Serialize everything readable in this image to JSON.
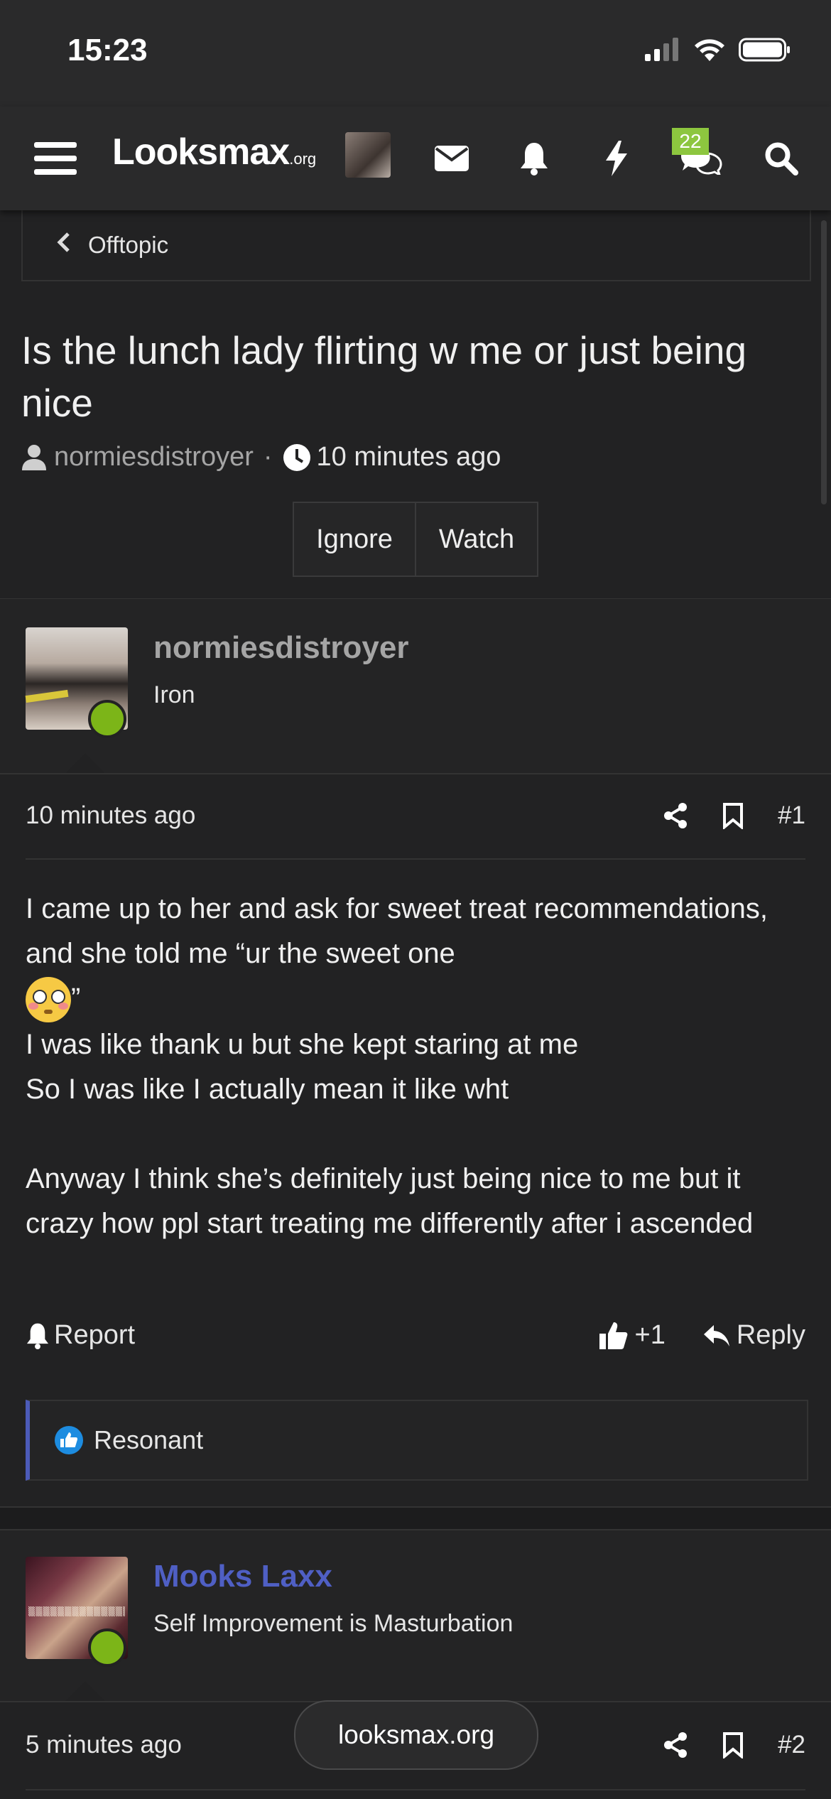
{
  "status_bar": {
    "time": "15:23"
  },
  "nav": {
    "logo_main": "Looksmax",
    "logo_suffix": ".org",
    "conversations_badge": "22"
  },
  "breadcrumb": {
    "label": "Offtopic"
  },
  "thread": {
    "title": "Is the lunch lady flirting w me or just being nice",
    "author": "normiesdistroyer",
    "time": "10 minutes ago",
    "ignore_label": "Ignore",
    "watch_label": "Watch"
  },
  "posts": [
    {
      "username": "normiesdistroyer",
      "user_title": "Iron",
      "time": "10 minutes ago",
      "number": "#1",
      "body_lines": [
        "I came up to her and ask for sweet treat recommendations, and she told me “ur the sweet one",
        "”",
        "I was like thank u but she kept staring at me",
        "So I was like I actually mean it like wht",
        "Anyway I think she’s definitely just being nice to me but it crazy how ppl start treating me differently after i ascended"
      ],
      "report_label": "Report",
      "like_label": "+1",
      "reply_label": "Reply",
      "reaction_label": "Resonant"
    },
    {
      "username": "Mooks Laxx",
      "user_title": "Self Improvement is Masturbation",
      "time": "5 minutes ago",
      "number": "#2"
    }
  ],
  "floating_domain": "looksmax.org",
  "colors": {
    "background": "#222223",
    "header": "#2a2a2b",
    "badge": "#8dc63f",
    "online": "#7cb518",
    "staff_name": "#4f5fc4",
    "username": "#a5a5a5"
  }
}
